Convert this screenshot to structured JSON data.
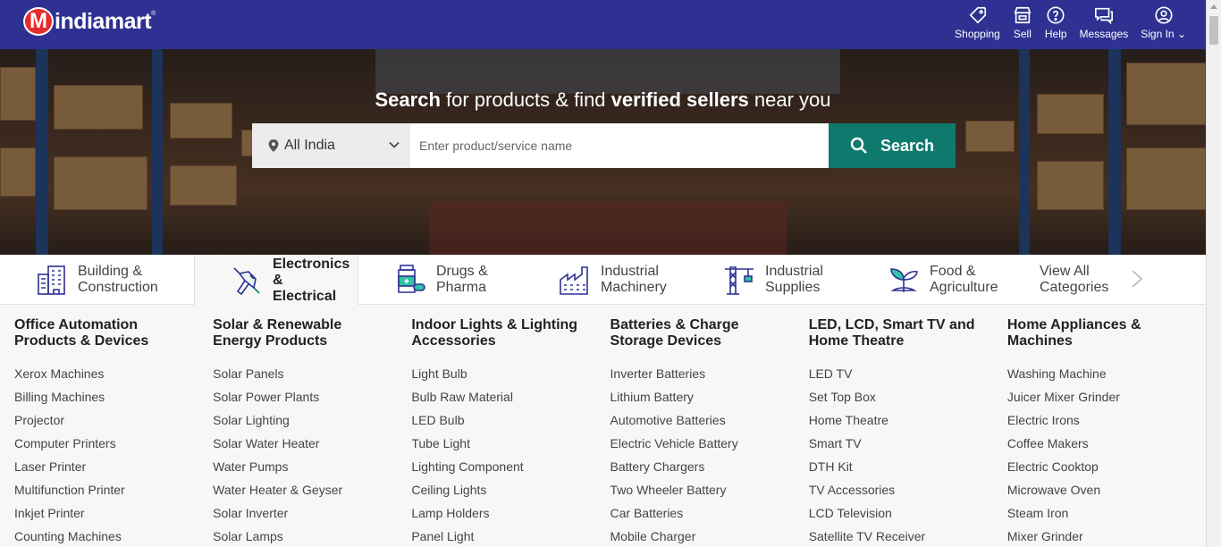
{
  "header": {
    "logo_text": "indiamart",
    "logo_mark": "M",
    "logo_reg": "®",
    "nav": [
      {
        "label": "Shopping",
        "icon": "tag-icon"
      },
      {
        "label": "Sell",
        "icon": "store-icon"
      },
      {
        "label": "Help",
        "icon": "help-icon"
      },
      {
        "label": "Messages",
        "icon": "messages-icon"
      },
      {
        "label": "Sign In ⌄",
        "icon": "user-icon"
      }
    ]
  },
  "hero": {
    "title_part1": "Search",
    "title_part2": " for products & find ",
    "title_part3": "verified sellers",
    "title_part4": " near you",
    "location": "All India",
    "search_placeholder": "Enter product/service name",
    "search_button": "Search"
  },
  "tabs": [
    {
      "line1": "Building &",
      "line2": "Construction",
      "active": false
    },
    {
      "line1": "Electronics &",
      "line2": "Electrical",
      "active": true
    },
    {
      "line1": "Drugs &",
      "line2": "Pharma",
      "active": false
    },
    {
      "line1": "Industrial",
      "line2": "Machinery",
      "active": false
    },
    {
      "line1": "Industrial",
      "line2": "Supplies",
      "active": false
    },
    {
      "line1": "Food &",
      "line2": "Agriculture",
      "active": false
    },
    {
      "line1": "View All",
      "line2": "Categories",
      "active": false
    }
  ],
  "columns": [
    {
      "title": "Office Automation Products & Devices",
      "items": [
        "Xerox Machines",
        "Billing Machines",
        "Projector",
        "Computer Printers",
        "Laser Printer",
        "Multifunction Printer",
        "Inkjet Printer",
        "Counting Machines"
      ]
    },
    {
      "title": "Solar & Renewable Energy Products",
      "items": [
        "Solar Panels",
        "Solar Power Plants",
        "Solar Lighting",
        "Solar Water Heater",
        "Water Pumps",
        "Water Heater & Geyser",
        "Solar Inverter",
        "Solar Lamps"
      ]
    },
    {
      "title": "Indoor Lights & Lighting Accessories",
      "items": [
        "Light Bulb",
        "Bulb Raw Material",
        "LED Bulb",
        "Tube Light",
        "Lighting Component",
        "Ceiling Lights",
        "Lamp Holders",
        "Panel Light"
      ]
    },
    {
      "title": "Batteries & Charge Storage Devices",
      "items": [
        "Inverter Batteries",
        "Lithium Battery",
        "Automotive Batteries",
        "Electric Vehicle Battery",
        "Battery Chargers",
        "Two Wheeler Battery",
        "Car Batteries",
        "Mobile Charger"
      ]
    },
    {
      "title": "LED, LCD, Smart TV and Home Theatre",
      "items": [
        "LED TV",
        "Set Top Box",
        "Home Theatre",
        "Smart TV",
        "DTH Kit",
        "TV Accessories",
        "LCD Television",
        "Satellite TV Receiver"
      ]
    },
    {
      "title": "Home Appliances & Machines",
      "items": [
        "Washing Machine",
        "Juicer Mixer Grinder",
        "Electric Irons",
        "Coffee Makers",
        "Electric Cooktop",
        "Microwave Oven",
        "Steam Iron",
        "Mixer Grinder"
      ]
    }
  ]
}
